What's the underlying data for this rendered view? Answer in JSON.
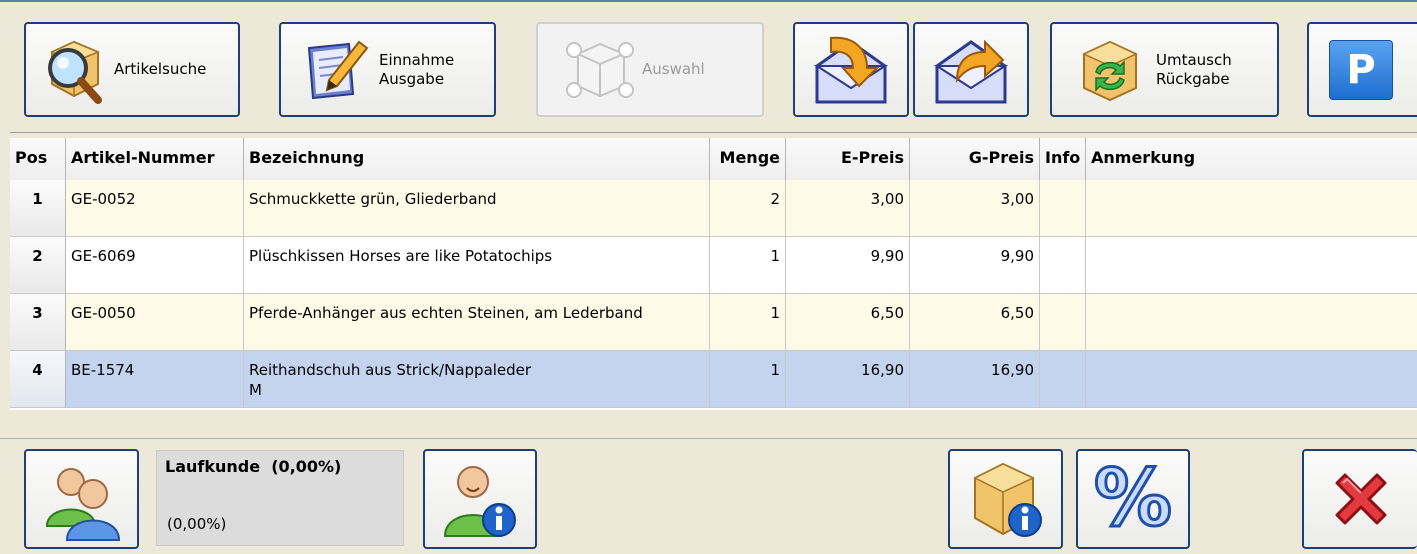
{
  "toolbar": {
    "artikelsuche": "Artikelsuche",
    "einnahme_ausgabe": "Einnahme\nAusgabe",
    "auswahl": "Auswahl",
    "umtausch_rueckgabe": "Umtausch\nRückgabe",
    "p_label": "P"
  },
  "table": {
    "headers": {
      "pos": "Pos",
      "artikel_nummer": "Artikel-Nummer",
      "bezeichnung": "Bezeichnung",
      "menge": "Menge",
      "e_preis": "E-Preis",
      "g_preis": "G-Preis",
      "info": "Info",
      "anmerkung": "Anmerkung"
    },
    "rows": [
      {
        "pos": "1",
        "artikel": "GE-0052",
        "bez": "Schmuckkette grün, Gliederband",
        "bez2": "",
        "menge": "2",
        "e_preis": "3,00",
        "g_preis": "3,00",
        "info": "",
        "anmerkung": ""
      },
      {
        "pos": "2",
        "artikel": "GE-6069",
        "bez": "Plüschkissen Horses are like Potatochips",
        "bez2": "",
        "menge": "1",
        "e_preis": "9,90",
        "g_preis": "9,90",
        "info": "",
        "anmerkung": ""
      },
      {
        "pos": "3",
        "artikel": "GE-0050",
        "bez": "Pferde-Anhänger aus echten Steinen, am Lederband",
        "bez2": "",
        "menge": "1",
        "e_preis": "6,50",
        "g_preis": "6,50",
        "info": "",
        "anmerkung": ""
      },
      {
        "pos": "4",
        "artikel": "BE-1574",
        "bez": "Reithandschuh aus Strick/Nappaleder",
        "bez2": "M",
        "menge": "1",
        "e_preis": "16,90",
        "g_preis": "16,90",
        "info": "",
        "anmerkung": ""
      }
    ]
  },
  "customer": {
    "name": "Laufkunde  (0,00%)",
    "discount": "(0,00%)"
  },
  "bottom": {
    "percent_label": "%"
  },
  "colors": {
    "button_border": "#1e3f78",
    "selected_row": "#c5d4ee",
    "alt_row": "#fdfbe8",
    "p_button": "#2f7fdd",
    "cancel_red": "#d5171f"
  }
}
